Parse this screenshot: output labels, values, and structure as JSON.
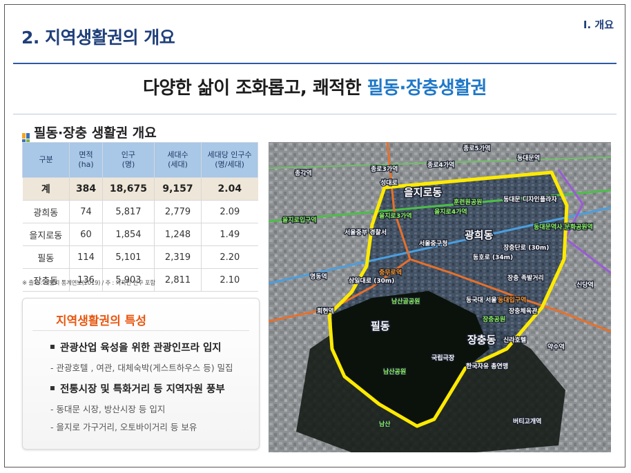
{
  "page": {
    "section_title": "2. 지역생활권의 개요",
    "corner_label": "Ⅰ. 개요",
    "headline_plain": "다양한 삶이 조화롭고, 쾌적한 ",
    "headline_highlight": "필동·장충생활권"
  },
  "overview": {
    "title": "필동·장충 생활권 개요",
    "columns": [
      "구분",
      "면적\n(ha)",
      "인구\n(명)",
      "세대수\n(세대)",
      "세대당 인구수\n(명/세대)"
    ],
    "total": [
      "계",
      "384",
      "18,675",
      "9,157",
      "2.04"
    ],
    "rows": [
      [
        "광희동",
        "74",
        "5,817",
        "2,779",
        "2.09"
      ],
      [
        "을지로동",
        "60",
        "1,854",
        "1,248",
        "1.49"
      ],
      [
        "필동",
        "114",
        "5,101",
        "2,319",
        "2.20"
      ],
      [
        "장충동",
        "136",
        "5,903",
        "2,811",
        "2.10"
      ]
    ],
    "source": "※ 출처 : 서울시 통계연보(2019) / 주 : 외국인 인구 포함"
  },
  "features": {
    "title": "지역생활권의 특성",
    "item1": "관광산업 육성을 위한 관광인프라 입지",
    "item1_sub": "- 관광호텔 , 여관, 대체숙박(게스트하우스 등) 밀집",
    "item2": "전통시장 및 특화거리 등 지역자원 풍부",
    "item2_sub1": "- 동대문 시장, 방산시장 등 입지",
    "item2_sub2": "- 을지로 가구거리, 오토바이거리 등 보유"
  },
  "map": {
    "districts": [
      "을지로동",
      "광희동",
      "필동",
      "장충동"
    ],
    "labels": [
      "종로5가역",
      "종로3가역",
      "종로4가역",
      "동대문역",
      "종각역",
      "성대로",
      "훈련원공원",
      "을지로입구역",
      "을지로3가역",
      "을지로4가역",
      "동대문 디자인플라자",
      "동대문역사 문화공원역",
      "서울중부 경찰서",
      "서울중구청",
      "장충단로 (30m)",
      "동호로 (34m)",
      "충무로역",
      "삼일대로 (30m)",
      "남산골공원",
      "동국대 서울캠",
      "동대입구역",
      "장충 족발거리",
      "장충체육관",
      "장충공원",
      "신라호텔",
      "국립극장",
      "한국자유 총연맹",
      "회현역",
      "명동역",
      "약수역",
      "신당역",
      "남산공원",
      "남산",
      "버티고개역"
    ],
    "colors": {
      "boundary": "#ffea00",
      "line1": "#4a9fe0",
      "line2": "#4cbf47",
      "line3": "#e8702a",
      "line4": "#9a5bd6",
      "label_green": "#8cf55c",
      "label_orange": "#ff9a2a"
    }
  }
}
